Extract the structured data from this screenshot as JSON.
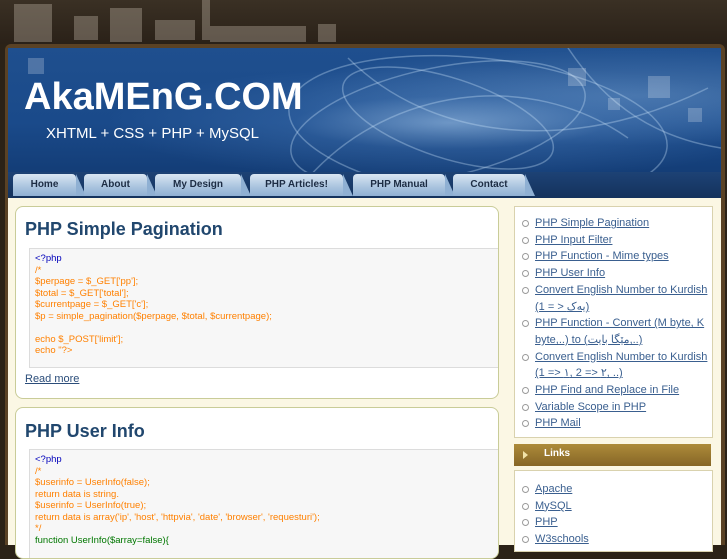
{
  "site": {
    "title": "AkaMEnG.COM",
    "tagline": "XHTML + CSS + PHP + MySQL"
  },
  "nav": {
    "items": [
      "Home",
      "About",
      "My Design",
      "PHP Articles!",
      "PHP Manual",
      "Contact"
    ]
  },
  "posts": [
    {
      "title": "PHP Simple Pagination",
      "code": [
        {
          "t": "<?php",
          "c": "kw"
        },
        {
          "t": "/*",
          "c": "cm"
        },
        {
          "t": "$perpage = $_GET['pp'];",
          "c": "cm"
        },
        {
          "t": "$total = $_GET['total'];",
          "c": "cm"
        },
        {
          "t": "$currentpage = $_GET['c'];",
          "c": "cm"
        },
        {
          "t": "$p = simple_pagination($perpage, $total, $currentpage);",
          "c": "cm"
        },
        {
          "t": "",
          "c": "cm"
        },
        {
          "t": "echo $_POST['limit'];",
          "c": "cm"
        },
        {
          "t": "echo \"?>",
          "c": "cm"
        }
      ],
      "read_more": "Read more"
    },
    {
      "title": "PHP User Info",
      "code": [
        {
          "t": "<?php",
          "c": "kw"
        },
        {
          "t": "/*",
          "c": "cm"
        },
        {
          "t": "$userinfo = UserInfo(false);",
          "c": "cm"
        },
        {
          "t": "return data is string.",
          "c": "cm"
        },
        {
          "t": "$userinfo = UserInfo(true);",
          "c": "cm"
        },
        {
          "t": "return data is array('ip', 'host', 'httpvia', 'date', 'browser', 'requesturi');",
          "c": "cm"
        },
        {
          "t": "*/",
          "c": "cm"
        },
        {
          "t": "function UserInfo($array=false){",
          "c": "gr"
        }
      ]
    }
  ],
  "sidebar": {
    "recent": [
      "PHP Simple Pagination",
      "PHP Input Filter",
      "PHP Function - Mime types",
      "PHP User Info",
      "Convert English Number to Kurdish (1 = > یەک)",
      "PHP Function - Convert (M byte, K byte,..) to (مێگا بایت,..)",
      "Convert English Number to Kurdish (1 => ١, 2 => ٢, ..)",
      "PHP Find and Replace in File",
      "Variable Scope in PHP",
      "PHP Mail"
    ],
    "links_title": "Links",
    "links": [
      "Apache",
      "MySQL",
      "PHP",
      "W3schools"
    ]
  },
  "colors": {
    "header_blue": "#1a4a8a",
    "post_title": "#21476e",
    "link": "#3a5f8f",
    "code_comment": "#ff8000",
    "code_keyword": "#0000bb",
    "links_header": "#9a7a30"
  }
}
